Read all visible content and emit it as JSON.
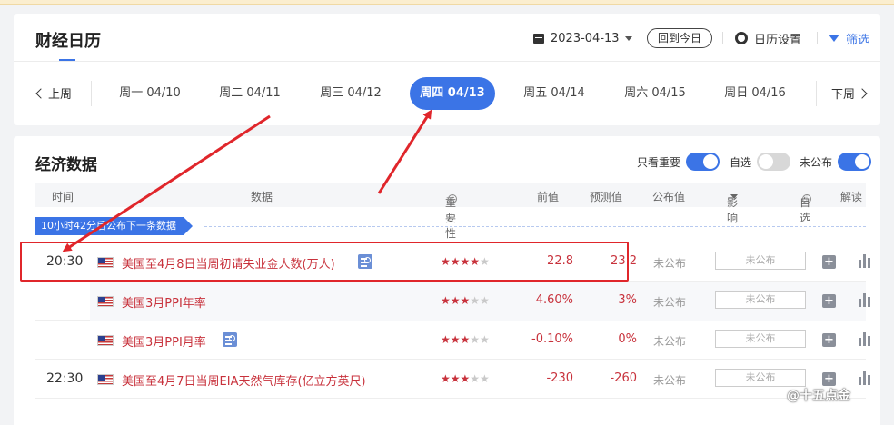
{
  "header": {
    "title": "财经日历",
    "date": "2023-04-13",
    "today_button": "回到今日",
    "settings": "日历设置",
    "filter": "筛选"
  },
  "week": {
    "prev": "上周",
    "next": "下周",
    "days": [
      "周一 04/10",
      "周二 04/11",
      "周三 04/12",
      "周四 04/13",
      "周五 04/14",
      "周六 04/15",
      "周日 04/16"
    ],
    "active_index": 3
  },
  "section": {
    "title": "经济数据",
    "toggle_important": {
      "label": "只看重要",
      "on": true
    },
    "toggle_custom": {
      "label": "自选",
      "on": false
    },
    "toggle_unpublished": {
      "label": "未公布",
      "on": true
    }
  },
  "columns": {
    "time": "时间",
    "data": "数据",
    "importance": "重要性",
    "previous": "前值",
    "forecast": "预测值",
    "actual": "公布值",
    "impact": "影响",
    "watch": "自选",
    "explain": "解读"
  },
  "banner": "10小时42分后公布下一条数据",
  "rows": [
    {
      "time": "20:30",
      "name": "美国至4月8日当周初请失业金人数(万人)",
      "has_doc": true,
      "stars": 4,
      "previous": "22.8",
      "forecast": "23.2",
      "actual": "未公布",
      "impact": "未公布"
    },
    {
      "time": "",
      "name": "美国3月PPI年率",
      "has_doc": false,
      "stars": 3,
      "previous": "4.60%",
      "forecast": "3%",
      "actual": "未公布",
      "impact": "未公布"
    },
    {
      "time": "",
      "name": "美国3月PPI月率",
      "has_doc": true,
      "stars": 3,
      "previous": "-0.10%",
      "forecast": "0%",
      "actual": "未公布",
      "impact": "未公布"
    },
    {
      "time": "22:30",
      "name": "美国至4月7日当周EIA天然气库存(亿立方英尺)",
      "has_doc": false,
      "stars": 3,
      "previous": "-230",
      "forecast": "-260",
      "actual": "未公布",
      "impact": "未公布"
    }
  ],
  "watermark": "@十五点金",
  "colors": {
    "accent": "#3b74e6",
    "data_red": "#c8323c",
    "annotation_red": "#e0262b"
  }
}
